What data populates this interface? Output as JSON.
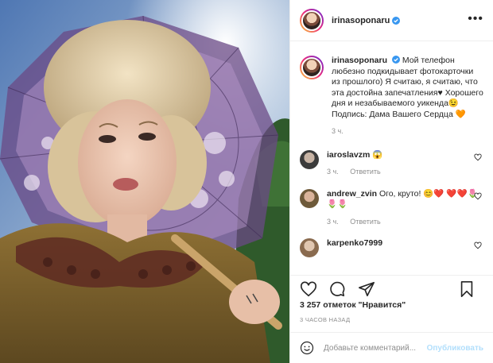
{
  "post": {
    "username": "irinasoponaru",
    "caption": "Мой телефон любезно подкидывает фотокарточки из прошлого) Я считаю, я считаю, что эта достойна запечатления♥ Хорошего дня и незабываемого уикенда😉 Подпись: Дама Вашего Сердца 🧡",
    "time": "3 ч.",
    "likes": "3 257 отметок \"Нравится\"",
    "date": "3 ЧАСОВ НАЗАД",
    "more_icon": "more-horizontal-icon"
  },
  "comments": [
    {
      "username": "iaroslavzm",
      "text": "😱",
      "time": "3 ч.",
      "reply": "Ответить"
    },
    {
      "username": "andrew_zvin",
      "text": "Ого, круто! 😊❤️ ❤️❤️🌷🌷🌷",
      "time": "3 ч.",
      "reply": "Ответить"
    },
    {
      "username": "karpenko7999",
      "text": ""
    }
  ],
  "composer": {
    "placeholder": "Добавьте комментарий...",
    "post_label": "Опубликовать"
  },
  "colors": {
    "verified": "#3897f0",
    "post_button_disabled": "#b2dffc",
    "muted_text": "#8e8e8e"
  }
}
